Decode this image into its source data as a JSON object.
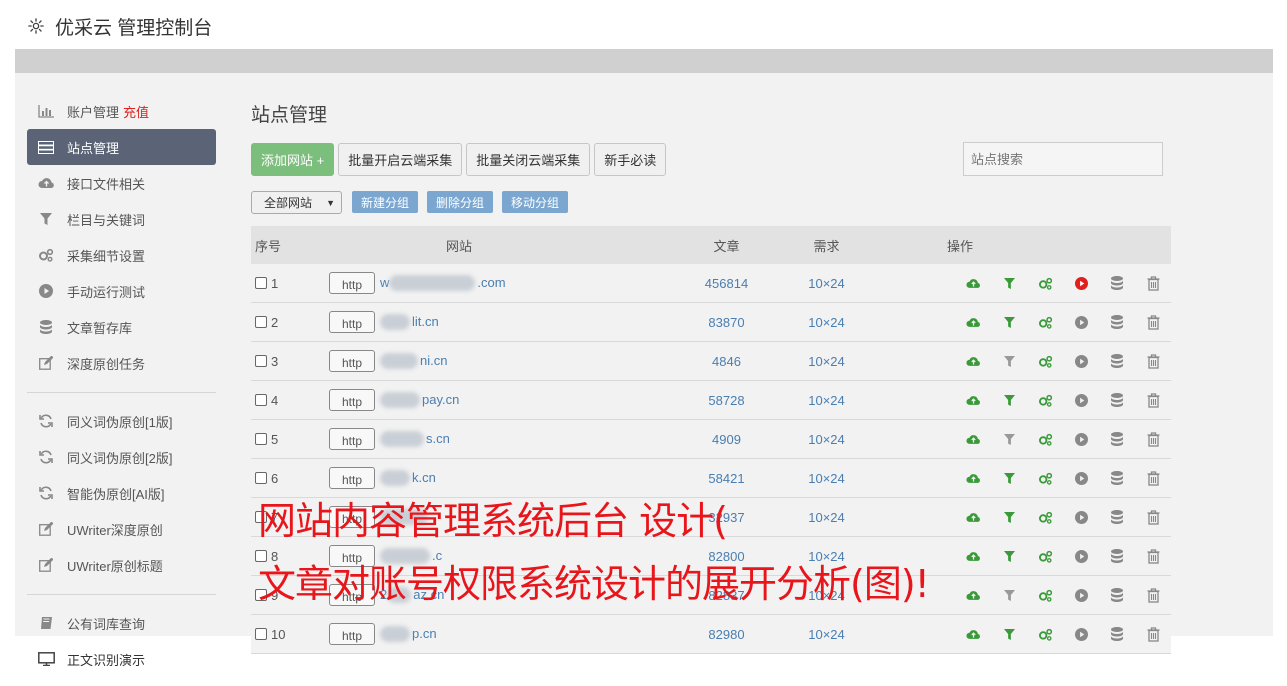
{
  "header": {
    "title": "优采云 管理控制台",
    "icon": "gear-icon"
  },
  "sidebar": {
    "items": [
      {
        "label": "账户管理",
        "extra": "充值",
        "icon": "bar-chart-icon"
      },
      {
        "label": "站点管理",
        "icon": "server-icon",
        "active": true
      },
      {
        "label": "接口文件相关",
        "icon": "cloud-upload-icon"
      },
      {
        "label": "栏目与关键词",
        "icon": "filter-icon"
      },
      {
        "label": "采集细节设置",
        "icon": "cogs-icon"
      },
      {
        "label": "手动运行测试",
        "icon": "play-icon"
      },
      {
        "label": "文章暂存库",
        "icon": "database-icon"
      },
      {
        "label": "深度原创任务",
        "icon": "edit-icon"
      }
    ],
    "items2": [
      {
        "label": "同义词伪原创[1版]",
        "icon": "refresh-icon"
      },
      {
        "label": "同义词伪原创[2版]",
        "icon": "refresh-icon"
      },
      {
        "label": "智能伪原创[AI版]",
        "icon": "refresh-icon"
      },
      {
        "label": "UWriter深度原创",
        "icon": "edit-icon"
      },
      {
        "label": "UWriter原创标题",
        "icon": "edit-icon"
      }
    ],
    "items3": [
      {
        "label": "公有词库查询",
        "icon": "book-icon"
      },
      {
        "label": "正文识别演示",
        "icon": "monitor-icon"
      }
    ]
  },
  "main": {
    "title": "站点管理",
    "add_button": "添加网站 +",
    "batch_open": "批量开启云端采集",
    "batch_close": "批量关闭云端采集",
    "guide": "新手必读",
    "search_placeholder": "站点搜索",
    "group_select": "全部网站",
    "new_group": "新建分组",
    "delete_group": "删除分组",
    "move_group": "移动分组"
  },
  "table": {
    "headers": {
      "no": "序号",
      "site": "网站",
      "articles": "文章",
      "demand": "需求",
      "ops": "操作"
    },
    "rows": [
      {
        "no": "1",
        "prefix": "w",
        "suffix": ".com",
        "articles": "456814",
        "demand": "10×24",
        "play_active": true,
        "filter_active": true
      },
      {
        "no": "2",
        "prefix": "",
        "suffix": "lit.cn",
        "articles": "83870",
        "demand": "10×24",
        "play_active": false,
        "filter_active": true
      },
      {
        "no": "3",
        "prefix": "",
        "suffix": "ni.cn",
        "articles": "4846",
        "demand": "10×24",
        "play_active": false,
        "filter_active": false
      },
      {
        "no": "4",
        "prefix": "",
        "suffix": "pay.cn",
        "articles": "58728",
        "demand": "10×24",
        "play_active": false,
        "filter_active": true
      },
      {
        "no": "5",
        "prefix": "",
        "suffix": "s.cn",
        "articles": "4909",
        "demand": "10×24",
        "play_active": false,
        "filter_active": false
      },
      {
        "no": "6",
        "prefix": "",
        "suffix": "k.cn",
        "articles": "58421",
        "demand": "10×24",
        "play_active": false,
        "filter_active": true
      },
      {
        "no": "7",
        "prefix": "",
        "suffix": "",
        "articles": "32937",
        "demand": "10×24",
        "play_active": false,
        "filter_active": true
      },
      {
        "no": "8",
        "prefix": "",
        "suffix": ".c",
        "articles": "82800",
        "demand": "10×24",
        "play_active": false,
        "filter_active": true
      },
      {
        "no": "9",
        "prefix": "2",
        "suffix": "az.cn",
        "articles": "82837",
        "demand": "10×24",
        "play_active": false,
        "filter_active": false
      },
      {
        "no": "10",
        "prefix": "",
        "suffix": "p.cn",
        "articles": "82980",
        "demand": "10×24",
        "play_active": false,
        "filter_active": true
      }
    ],
    "http_label": "http"
  },
  "overlay": {
    "line1": "网站内容管理系统后台 设计(",
    "line2": "文章对账号权限系统设计的展开分析(图)!"
  },
  "colors": {
    "accent_green": "#3a9a3a",
    "play_red": "#e0201c",
    "link_blue": "#4a7eb0",
    "sidebar_active": "#5a6476",
    "caption_red": "#e8151b"
  }
}
